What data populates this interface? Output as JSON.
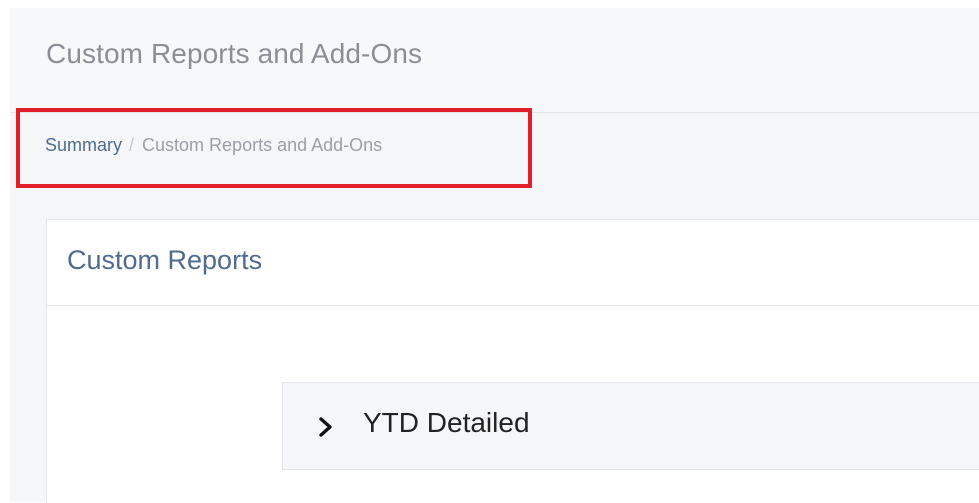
{
  "header": {
    "title": "Custom Reports and Add-Ons"
  },
  "breadcrumb": {
    "items": [
      {
        "label": "Summary"
      },
      {
        "label": "Custom Reports and Add-Ons"
      }
    ],
    "separator": "/"
  },
  "highlight": {
    "color": "#e01f26"
  },
  "custom_reports": {
    "title": "Custom Reports",
    "items": [
      {
        "label": "YTD Detailed",
        "icon": "chevron-right-icon",
        "expanded": false
      }
    ]
  },
  "colors": {
    "link": "#4f6b8e",
    "muted_text": "#9aa0a6",
    "panel_background": "#f5f6f8"
  }
}
